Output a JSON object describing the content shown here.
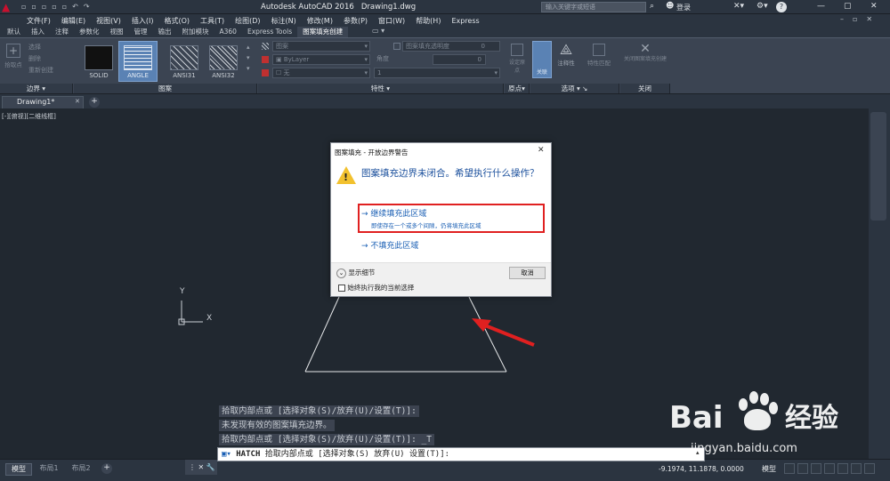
{
  "app": {
    "title": "Autodesk AutoCAD 2016",
    "document": "Drawing1.dwg"
  },
  "titlebar": {
    "search_placeholder": "输入关键字或短语",
    "login_label": "登录",
    "help_icon": "?"
  },
  "menubar": {
    "items": [
      "文件(F)",
      "编辑(E)",
      "视图(V)",
      "插入(I)",
      "格式(O)",
      "工具(T)",
      "绘图(D)",
      "标注(N)",
      "修改(M)",
      "参数(P)",
      "窗口(W)",
      "帮助(H)",
      "Express"
    ]
  },
  "ribbon_tabs": {
    "items": [
      "默认",
      "插入",
      "注释",
      "参数化",
      "视图",
      "管理",
      "输出",
      "附加模块",
      "A360",
      "Express Tools",
      "图案填充创建"
    ],
    "active_index": 10
  },
  "ribbon": {
    "boundary": {
      "add_label": "拾取点",
      "select_label": "选择",
      "remove_label": "删除",
      "recreate_label": "重新创建",
      "panel_label": "边界"
    },
    "pattern": {
      "items": [
        "SOLID",
        "ANGLE",
        "ANSI31",
        "ANSI32"
      ],
      "panel_label": "图案"
    },
    "properties": {
      "pattern_type": "图案",
      "transparency_label": "图案填充透明度",
      "transparency_value": "0",
      "color_value": "ByLayer",
      "angle_label": "角度",
      "angle_value": "0",
      "bgcolor_value": "无",
      "scale_value": "1",
      "panel_label": "特性"
    },
    "origin": {
      "set_label": "设定原点",
      "panel_label": "原点"
    },
    "options": {
      "assoc_label": "关联",
      "annot_label": "注释性",
      "match_label": "特性匹配",
      "panel_label": "选项"
    },
    "close": {
      "label": "关闭图案填充创建",
      "panel_label": "关闭"
    }
  },
  "doctabs": {
    "active": "Drawing1*"
  },
  "viewport": {
    "label": "[-][俯视][二维线框]"
  },
  "ucs": {
    "y": "Y",
    "x": "X"
  },
  "dialog": {
    "title": "图案填充 - 开放边界警告",
    "question": "图案填充边界未闭合。希望执行什么操作？",
    "opt1_title": "继续填充此区域",
    "opt1_desc": "即使存在一个或多个间隙，仍将填充此区域",
    "opt2_title": "不填充此区域",
    "details_label": "显示细节",
    "cancel_label": "取消",
    "always_label": "始终执行我的当前选择"
  },
  "command": {
    "history": [
      "拾取内部点或 [选择对象(S)/放弃(U)/设置(T)]:",
      "未发现有效的图案填充边界。",
      "拾取内部点或 [选择对象(S)/放弃(U)/设置(T)]: _T"
    ],
    "prompt_cmd": "HATCH",
    "prompt_text": "拾取内部点或 [选择对象(S) 放弃(U) 设置(T)]:"
  },
  "layout_tabs": [
    "模型",
    "布局1",
    "布局2"
  ],
  "status": {
    "coords": "-9.1974, 11.1878, 0.0000",
    "model": "模型"
  },
  "watermark": {
    "brand": "Bai",
    "brand2": "经验",
    "url": "jingyan.baidu.com"
  },
  "colors": {
    "accent": "#1a5fb4",
    "highlight_box": "#e02020",
    "arrow": "#e02020",
    "autocad_red": "#c8102e"
  }
}
